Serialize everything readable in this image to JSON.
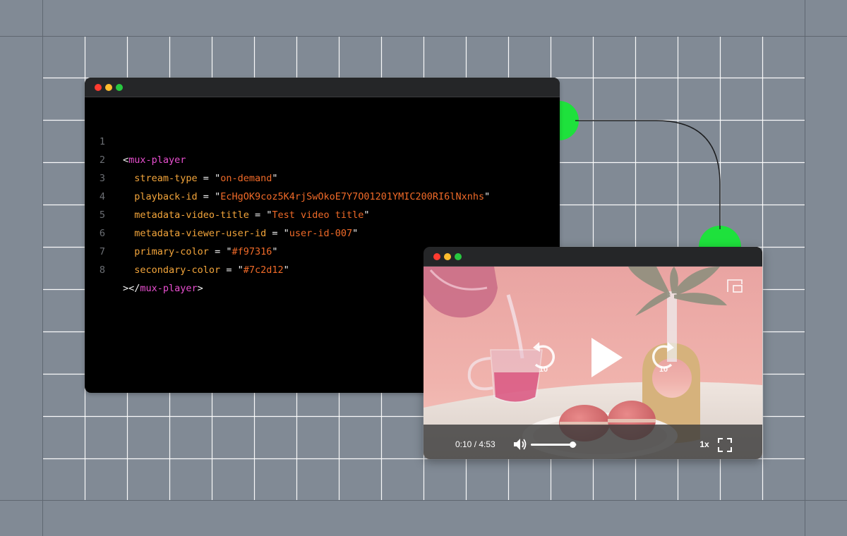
{
  "colors": {
    "background": "#818a95",
    "grid_line": "#ffffff",
    "connector_node": "#1ee13c",
    "tag": "#e94fd0",
    "attribute": "#f3a53b",
    "string": "#f06a28",
    "window_close": "#ff3b30",
    "window_minimize": "#febc2e",
    "window_maximize": "#28c840"
  },
  "code_editor": {
    "lines": [
      {
        "number": "1",
        "open": "<",
        "tag": "mux-player"
      },
      {
        "number": "2",
        "attr": "stream-type",
        "eq": " = ",
        "q1": "\"",
        "value": "on-demand",
        "q2": "\""
      },
      {
        "number": "3",
        "attr": "playback-id",
        "eq": " = ",
        "q1": "\"",
        "value": "EcHgOK9coz5K4rjSwOkoE7Y7O01201YMIC200RI6lNxnhs",
        "q2": "\""
      },
      {
        "number": "4",
        "attr": "metadata-video-title",
        "eq": " = ",
        "q1": "\"",
        "value": "Test video title",
        "q2": "\""
      },
      {
        "number": "5",
        "attr": "metadata-viewer-user-id",
        "eq": " = ",
        "q1": "\"",
        "value": "user-id-007",
        "q2": "\""
      },
      {
        "number": "6",
        "attr": "primary-color",
        "eq": " = ",
        "q1": "\"",
        "value": "#f97316",
        "q2": "\""
      },
      {
        "number": "7",
        "attr": "secondary-color",
        "eq": " = ",
        "q1": "\"",
        "value": "#7c2d12",
        "q2": "\""
      },
      {
        "number": "8",
        "open": "></",
        "tag": "mux-player",
        "close": ">"
      }
    ]
  },
  "video_player": {
    "seek_backward_seconds": "10",
    "seek_forward_seconds": "10",
    "time_display": "0:10 / 4:53",
    "volume_level": 0.9,
    "playback_rate": "1x",
    "icons": {
      "pip": "picture-in-picture-icon",
      "rewind": "rewind-10-icon",
      "play": "play-icon",
      "forward": "forward-10-icon",
      "mute": "volume-icon",
      "fullscreen": "fullscreen-icon"
    }
  }
}
